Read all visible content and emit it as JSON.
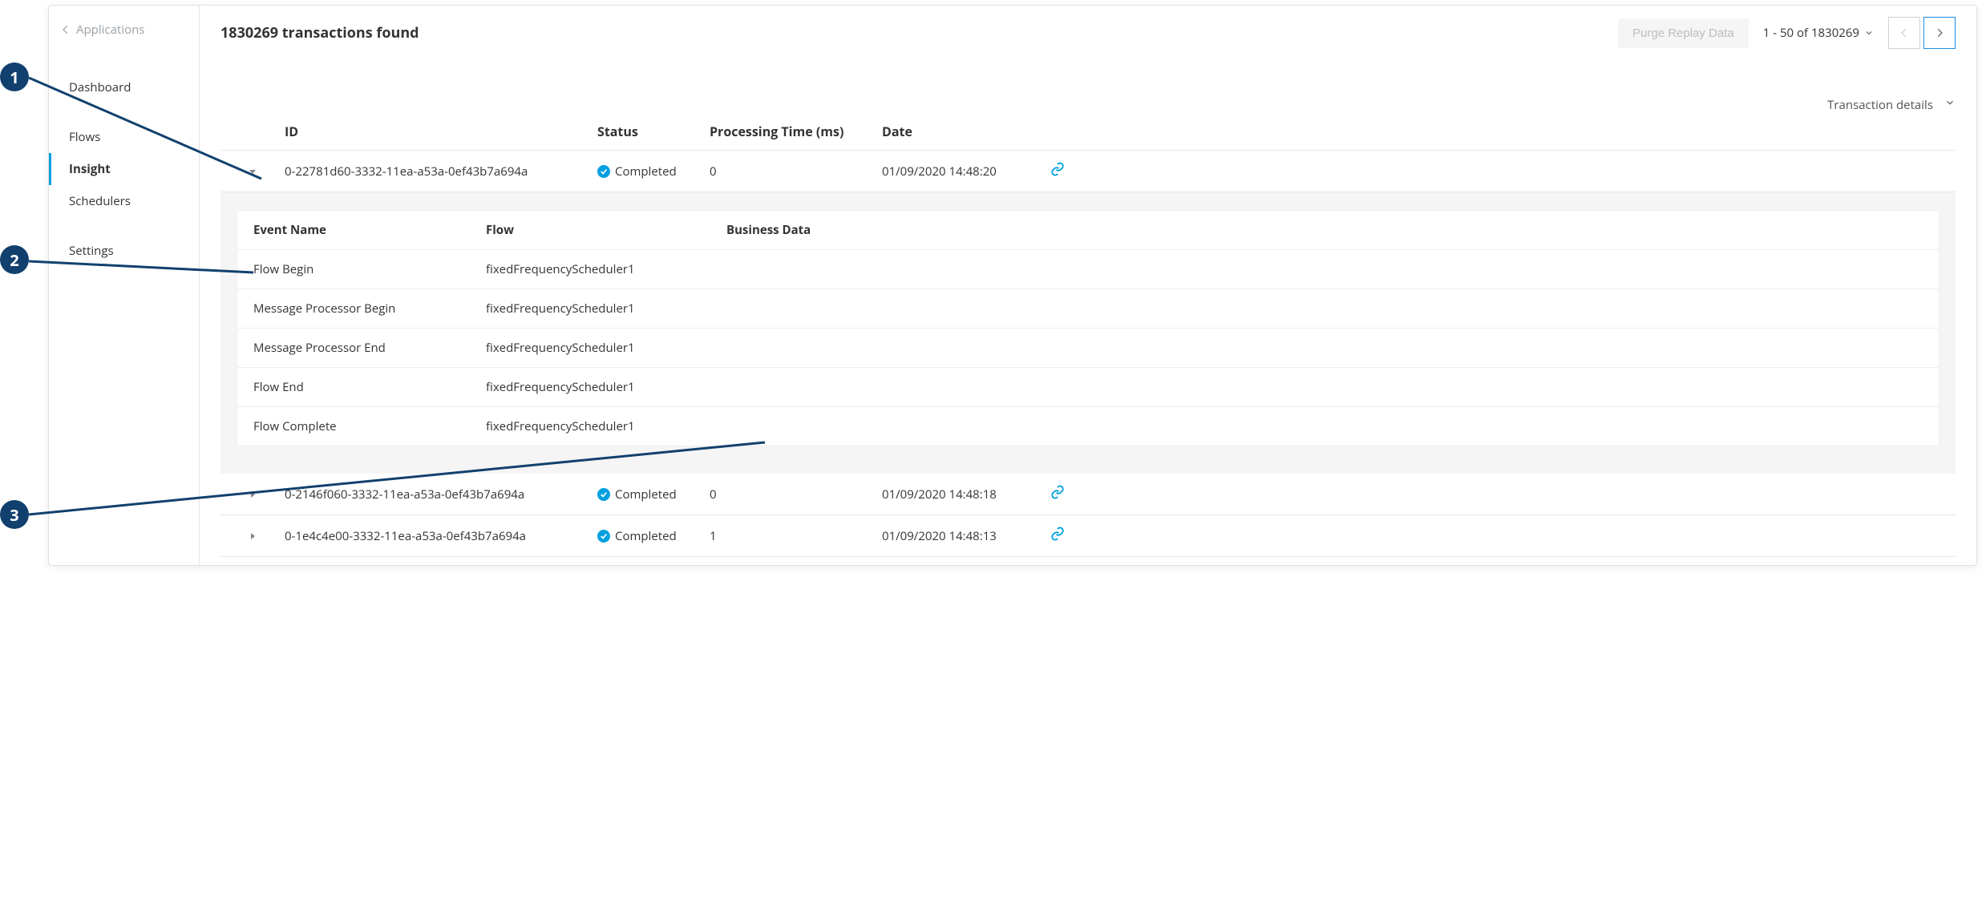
{
  "sidebar": {
    "back_label": "Applications",
    "items": [
      {
        "label": "Dashboard"
      },
      {
        "label": "Flows"
      },
      {
        "label": "Insight",
        "active": true
      },
      {
        "label": "Schedulers"
      },
      {
        "label": "Settings"
      }
    ]
  },
  "header": {
    "title": "1830269 transactions found",
    "purge_label": "Purge Replay Data",
    "pagination_label": "1 - 50 of 1830269",
    "transaction_details_label": "Transaction details"
  },
  "columns": {
    "id": "ID",
    "status": "Status",
    "ptime": "Processing Time (ms)",
    "date": "Date"
  },
  "rows": [
    {
      "id": "0-22781d60-3332-11ea-a53a-0ef43b7a694a",
      "status": "Completed",
      "ptime": "0",
      "date": "01/09/2020 14:48:20",
      "expanded": true,
      "events": [
        {
          "name": "Flow Begin",
          "flow": "fixedFrequencyScheduler1",
          "bd": ""
        },
        {
          "name": "Message Processor Begin",
          "flow": "fixedFrequencyScheduler1",
          "bd": ""
        },
        {
          "name": "Message Processor End",
          "flow": "fixedFrequencyScheduler1",
          "bd": ""
        },
        {
          "name": "Flow End",
          "flow": "fixedFrequencyScheduler1",
          "bd": ""
        },
        {
          "name": "Flow Complete",
          "flow": "fixedFrequencyScheduler1",
          "bd": ""
        }
      ]
    },
    {
      "id": "0-2146f060-3332-11ea-a53a-0ef43b7a694a",
      "status": "Completed",
      "ptime": "0",
      "date": "01/09/2020 14:48:18"
    },
    {
      "id": "0-1e4c4e00-3332-11ea-a53a-0ef43b7a694a",
      "status": "Completed",
      "ptime": "1",
      "date": "01/09/2020 14:48:13"
    }
  ],
  "sub_columns": {
    "event": "Event Name",
    "flow": "Flow",
    "bd": "Business Data"
  },
  "annotations": {
    "c1": "1",
    "c2": "2",
    "c3": "3"
  }
}
